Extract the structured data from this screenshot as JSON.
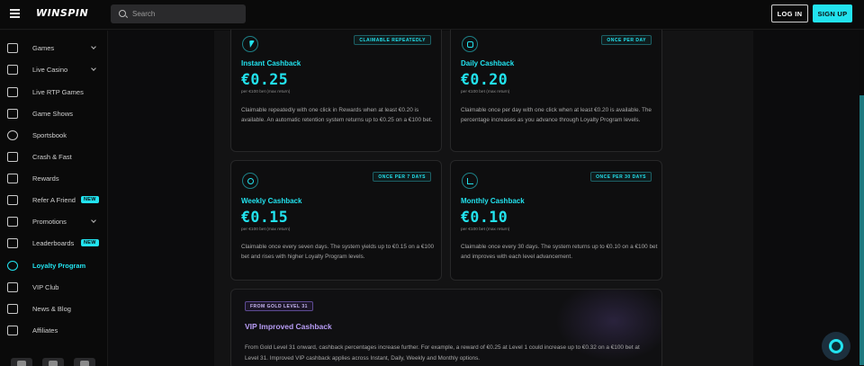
{
  "header": {
    "logo_text": "WINSPIN",
    "search_placeholder": "Search",
    "login_label": "LOG IN",
    "signup_label": "SIGN UP"
  },
  "sidebar": {
    "items": [
      {
        "label": "Games",
        "icon": "games-icon",
        "chevron": true
      },
      {
        "label": "Live Casino",
        "icon": "live-casino-icon",
        "chevron": true
      },
      {
        "label": "Live RTP Games",
        "icon": "rtp-icon"
      },
      {
        "label": "Game Shows",
        "icon": "game-shows-icon"
      },
      {
        "label": "Sportsbook",
        "icon": "sportsbook-icon"
      },
      {
        "label": "Crash & Fast",
        "icon": "crash-icon"
      },
      {
        "label": "Rewards",
        "icon": "trophy-icon"
      },
      {
        "label": "Refer A Friend",
        "icon": "refer-icon",
        "badge": "NEW"
      },
      {
        "label": "Promotions",
        "icon": "gift-icon",
        "chevron": true
      },
      {
        "label": "Leaderboards",
        "icon": "leaderboard-icon",
        "badge": "NEW"
      },
      {
        "label": "Loyalty Program",
        "icon": "loyalty-icon",
        "active": true
      },
      {
        "label": "VIP Club",
        "icon": "crown-icon"
      },
      {
        "label": "News & Blog",
        "icon": "news-icon"
      },
      {
        "label": "Affiliates",
        "icon": "affiliates-icon"
      }
    ]
  },
  "cards": [
    {
      "title": "Instant Cashback",
      "tag": "CLAIMABLE REPEATEDLY",
      "amount": "€0.25",
      "sub": "per €100 bet (max return)",
      "desc": "Claimable repeatedly with one click in Rewards when at least €0.20 is available. An automatic retention system returns up to €0.25 on a €100 bet.",
      "icon": "bolt-icon"
    },
    {
      "title": "Daily Cashback",
      "tag": "ONCE PER DAY",
      "amount": "€0.20",
      "sub": "per €100 bet (max return)",
      "desc": "Claimable once per day with one click when at least €0.20 is available. The percentage increases as you advance through Loyalty Program levels.",
      "icon": "calendar-icon"
    },
    {
      "title": "Weekly Cashback",
      "tag": "ONCE PER 7 DAYS",
      "amount": "€0.15",
      "sub": "per €100 bet (max return)",
      "desc": "Claimable once every seven days. The system yields up to €0.15 on a €100 bet and rises with higher Loyalty Program levels.",
      "icon": "clock-icon"
    },
    {
      "title": "Monthly Cashback",
      "tag": "ONCE PER 30 DAYS",
      "amount": "€0.10",
      "sub": "per €100 bet (max return)",
      "desc": "Claimable once every 30 days. The system returns up to €0.10 on a €100 bet and improves with each level advancement.",
      "icon": "chart-icon"
    }
  ],
  "vip": {
    "tag": "FROM GOLD LEVEL 31",
    "title": "VIP Improved Cashback",
    "desc": "From Gold Level 31 onward, cashback percentages increase further. For example, a reward of €0.25 at Level 1 could increase up to €0.32 on a €100 bet at Level 31. Improved VIP cashback applies across Instant, Daily, Weekly and Monthly options."
  },
  "colors": {
    "accent": "#22e3ef",
    "vip_accent": "#b79cf5",
    "background": "#0c0c0d"
  }
}
